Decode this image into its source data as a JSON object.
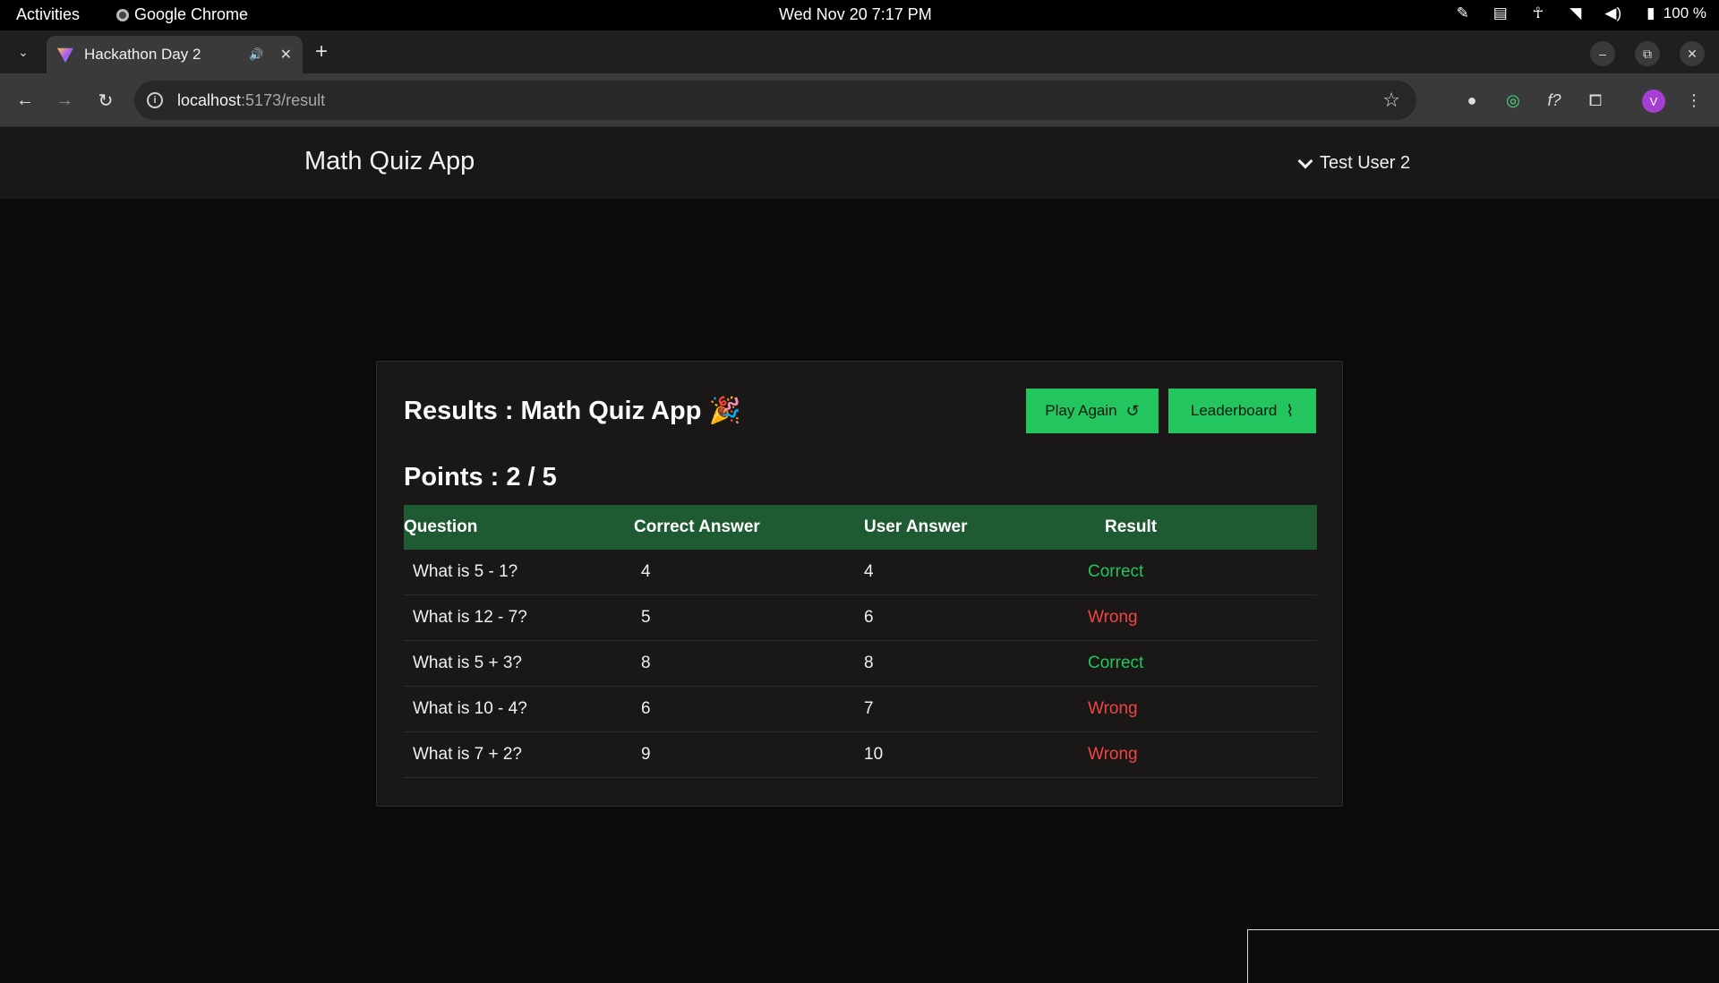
{
  "system_bar": {
    "activities": "Activities",
    "app_name": "Google Chrome",
    "clock": "Wed Nov 20  7:17 PM",
    "battery": "100 %"
  },
  "browser": {
    "tab_title": "Hackathon Day 2",
    "url_host": "localhost",
    "url_path": ":5173/result",
    "profile_initial": "V"
  },
  "app": {
    "title": "Math Quiz App",
    "user": "Test User 2"
  },
  "results": {
    "title": "Results : Math Quiz App 🎉",
    "points": "Points : 2 / 5",
    "play_again_label": "Play Again",
    "leaderboard_label": "Leaderboard",
    "columns": [
      "Question",
      "Correct Answer",
      "User Answer",
      "Result"
    ],
    "rows": [
      {
        "question": "What is 5 - 1?",
        "correct": "4",
        "user": "4",
        "result": "Correct"
      },
      {
        "question": "What is 12 - 7?",
        "correct": "5",
        "user": "6",
        "result": "Wrong"
      },
      {
        "question": "What is 5 + 3?",
        "correct": "8",
        "user": "8",
        "result": "Correct"
      },
      {
        "question": "What is 10 - 4?",
        "correct": "6",
        "user": "7",
        "result": "Wrong"
      },
      {
        "question": "What is 7 + 2?",
        "correct": "9",
        "user": "10",
        "result": "Wrong"
      }
    ]
  },
  "colors": {
    "accent_green": "#22c55e",
    "table_header": "#1e5a32",
    "wrong_red": "#ef4444"
  }
}
